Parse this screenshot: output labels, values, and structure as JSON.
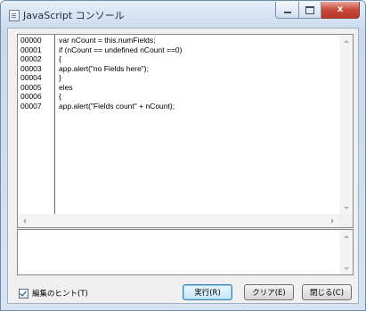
{
  "window": {
    "title": "JavaScript コンソール",
    "close_glyph": "x"
  },
  "code": {
    "line_numbers": [
      "00000",
      "00001",
      "00002",
      "00003",
      "00004",
      "00005",
      "00006",
      "00007"
    ],
    "lines": [
      "var nCount = this.numFields;",
      "if (nCount == undefined nCount ==0)",
      "{",
      "app.alert(\"no Fields here\");",
      "}",
      "eles",
      "{",
      "app.alert(\"Fields count\" + nCount);"
    ]
  },
  "output": {
    "text": ""
  },
  "footer": {
    "hint_checkbox_label": "編集のヒント(T)",
    "hint_checked": true,
    "run_label": "実行(R)",
    "clear_label": "クリア(E)",
    "close_label": "閉じる(C)"
  }
}
